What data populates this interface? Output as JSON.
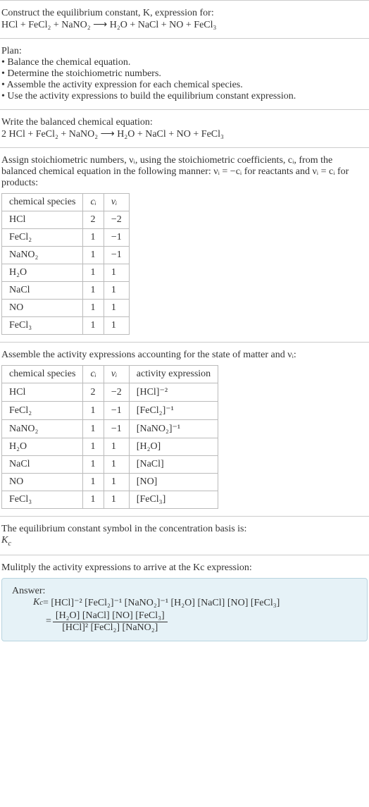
{
  "s1": {
    "l1": "Construct the equilibrium constant, K, expression for:",
    "l2": "HCl + FeCl₂ + NaNO₂ ⟶ H₂O + NaCl + NO + FeCl₃"
  },
  "s2": {
    "l1": "Plan:",
    "l2": "• Balance the chemical equation.",
    "l3": "• Determine the stoichiometric numbers.",
    "l4": "• Assemble the activity expression for each chemical species.",
    "l5": "• Use the activity expressions to build the equilibrium constant expression."
  },
  "s3": {
    "l1": "Write the balanced chemical equation:",
    "l2": "2 HCl + FeCl₂ + NaNO₂ ⟶ H₂O + NaCl + NO + FeCl₃"
  },
  "s4": {
    "l1": "Assign stoichiometric numbers, νᵢ, using the stoichiometric coefficients, cᵢ, from the balanced chemical equation in the following manner: νᵢ = −cᵢ for reactants and νᵢ = cᵢ for products:"
  },
  "t1": {
    "h1": "chemical species",
    "h2": "cᵢ",
    "h3": "νᵢ",
    "r1": {
      "a": "HCl",
      "b": "2",
      "c": "−2"
    },
    "r2": {
      "a": "FeCl₂",
      "b": "1",
      "c": "−1"
    },
    "r3": {
      "a": "NaNO₂",
      "b": "1",
      "c": "−1"
    },
    "r4": {
      "a": "H₂O",
      "b": "1",
      "c": "1"
    },
    "r5": {
      "a": "NaCl",
      "b": "1",
      "c": "1"
    },
    "r6": {
      "a": "NO",
      "b": "1",
      "c": "1"
    },
    "r7": {
      "a": "FeCl₃",
      "b": "1",
      "c": "1"
    }
  },
  "s5": {
    "l1": "Assemble the activity expressions accounting for the state of matter and νᵢ:"
  },
  "t2": {
    "h1": "chemical species",
    "h2": "cᵢ",
    "h3": "νᵢ",
    "h4": "activity expression",
    "r1": {
      "a": "HCl",
      "b": "2",
      "c": "−2",
      "d": "[HCl]⁻²"
    },
    "r2": {
      "a": "FeCl₂",
      "b": "1",
      "c": "−1",
      "d": "[FeCl₂]⁻¹"
    },
    "r3": {
      "a": "NaNO₂",
      "b": "1",
      "c": "−1",
      "d": "[NaNO₂]⁻¹"
    },
    "r4": {
      "a": "H₂O",
      "b": "1",
      "c": "1",
      "d": "[H₂O]"
    },
    "r5": {
      "a": "NaCl",
      "b": "1",
      "c": "1",
      "d": "[NaCl]"
    },
    "r6": {
      "a": "NO",
      "b": "1",
      "c": "1",
      "d": "[NO]"
    },
    "r7": {
      "a": "FeCl₃",
      "b": "1",
      "c": "1",
      "d": "[FeCl₃]"
    }
  },
  "s6": {
    "l1": "The equilibrium constant symbol in the concentration basis is:",
    "l2": "K",
    "l2sub": "c"
  },
  "s7": {
    "l1": "Mulitply the activity expressions to arrive at the Kc expression:"
  },
  "ans": {
    "title": "Answer:",
    "line1_lhs": "K",
    "line1_lhs_sub": "c",
    "line1_eq": " = [HCl]⁻² [FeCl₂]⁻¹ [NaNO₂]⁻¹ [H₂O] [NaCl] [NO] [FeCl₃]",
    "frac_eq": "= ",
    "frac_num": "[H₂O] [NaCl] [NO] [FeCl₃]",
    "frac_den": "[HCl]² [FeCl₂] [NaNO₂]"
  },
  "chart_data": {
    "type": "table",
    "tables": [
      {
        "columns": [
          "chemical species",
          "c_i",
          "ν_i"
        ],
        "rows": [
          [
            "HCl",
            2,
            -2
          ],
          [
            "FeCl2",
            1,
            -1
          ],
          [
            "NaNO2",
            1,
            -1
          ],
          [
            "H2O",
            1,
            1
          ],
          [
            "NaCl",
            1,
            1
          ],
          [
            "NO",
            1,
            1
          ],
          [
            "FeCl3",
            1,
            1
          ]
        ]
      },
      {
        "columns": [
          "chemical species",
          "c_i",
          "ν_i",
          "activity expression"
        ],
        "rows": [
          [
            "HCl",
            2,
            -2,
            "[HCl]^-2"
          ],
          [
            "FeCl2",
            1,
            -1,
            "[FeCl2]^-1"
          ],
          [
            "NaNO2",
            1,
            -1,
            "[NaNO2]^-1"
          ],
          [
            "H2O",
            1,
            1,
            "[H2O]"
          ],
          [
            "NaCl",
            1,
            1,
            "[NaCl]"
          ],
          [
            "NO",
            1,
            1,
            "[NO]"
          ],
          [
            "FeCl3",
            1,
            1,
            "[FeCl3]"
          ]
        ]
      }
    ]
  }
}
